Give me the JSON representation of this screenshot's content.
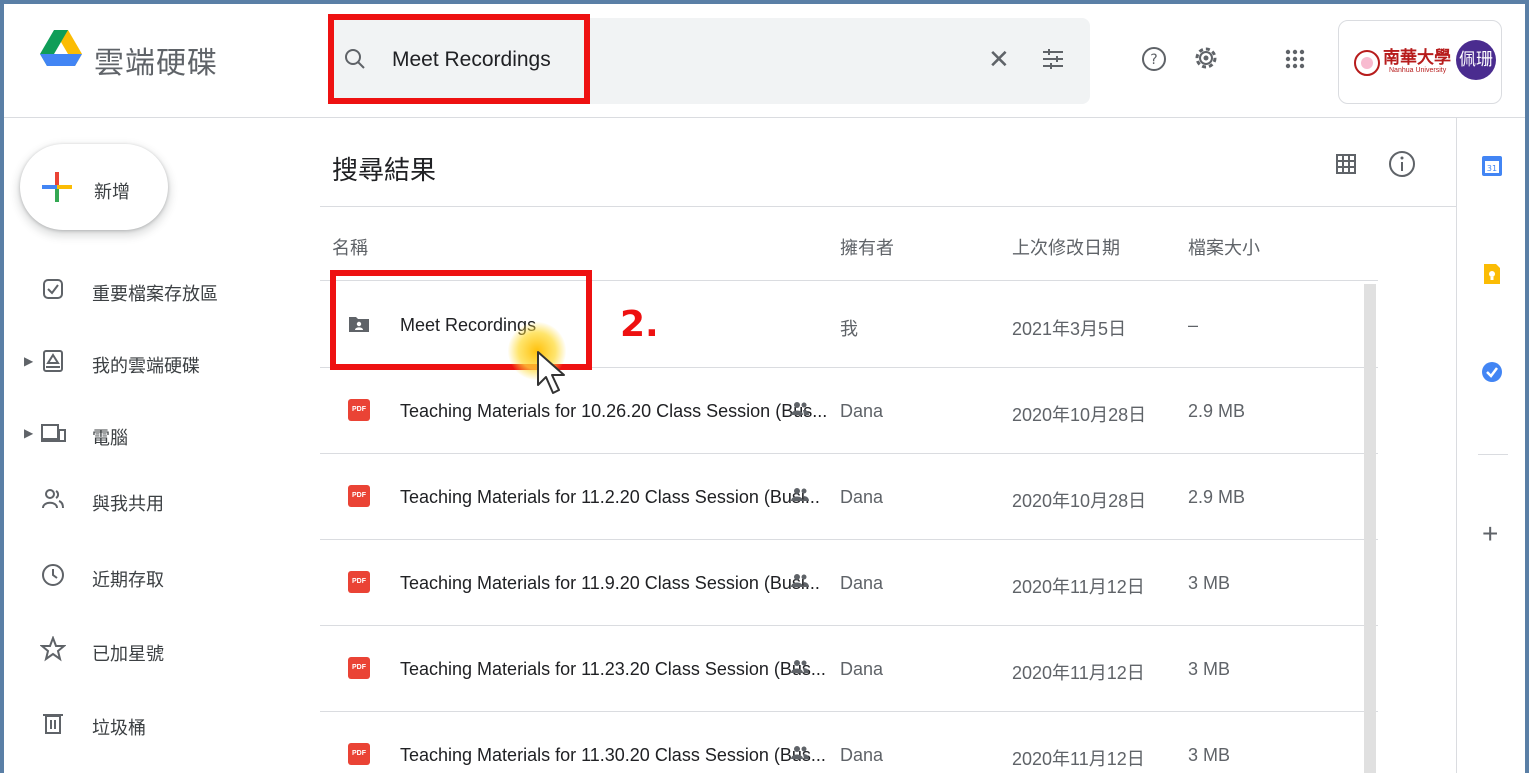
{
  "app": {
    "title": "雲端硬碟"
  },
  "search": {
    "value": "Meet Recordings"
  },
  "header": {
    "org_name": "南華大學",
    "org_sub": "Nanhua University",
    "avatar_label": "佩珊"
  },
  "sidebar": {
    "new_label": "新增",
    "items": [
      {
        "label": "重要檔案存放區",
        "icon": "priority-icon"
      },
      {
        "label": "我的雲端硬碟",
        "icon": "my-drive-icon"
      },
      {
        "label": "電腦",
        "icon": "computers-icon"
      },
      {
        "label": "與我共用",
        "icon": "shared-with-me-icon"
      },
      {
        "label": "近期存取",
        "icon": "recent-icon"
      },
      {
        "label": "已加星號",
        "icon": "starred-icon"
      },
      {
        "label": "垃圾桶",
        "icon": "trash-icon"
      }
    ]
  },
  "main": {
    "results_title": "搜尋結果",
    "columns": {
      "name": "名稱",
      "owner": "擁有者",
      "modified": "上次修改日期",
      "size": "檔案大小"
    },
    "rows": [
      {
        "name": "Meet Recordings",
        "type": "shared-folder",
        "owner": "我",
        "modified": "2021年3月5日",
        "size": "–",
        "shared": false
      },
      {
        "name": "Teaching Materials for 10.26.20 Class Session (Bus...",
        "type": "pdf",
        "owner": "Dana",
        "modified": "2020年10月28日",
        "size": "2.9 MB",
        "shared": true
      },
      {
        "name": "Teaching Materials for 11.2.20 Class Session (Busi...",
        "type": "pdf",
        "owner": "Dana",
        "modified": "2020年10月28日",
        "size": "2.9 MB",
        "shared": true
      },
      {
        "name": "Teaching Materials for 11.9.20 Class Session (Busi...",
        "type": "pdf",
        "owner": "Dana",
        "modified": "2020年11月12日",
        "size": "3 MB",
        "shared": true
      },
      {
        "name": "Teaching Materials for 11.23.20 Class Session (Bus...",
        "type": "pdf",
        "owner": "Dana",
        "modified": "2020年11月12日",
        "size": "3 MB",
        "shared": true
      },
      {
        "name": "Teaching Materials for 11.30.20 Class Session (Bus...",
        "type": "pdf",
        "owner": "Dana",
        "modified": "2020年11月12日",
        "size": "3 MB",
        "shared": true
      }
    ]
  },
  "file_badge": "PDF",
  "side_panel": {
    "calendar_day": "31",
    "apps": [
      "calendar-icon",
      "keep-icon",
      "tasks-icon"
    ]
  },
  "annotation": {
    "step_label": "2."
  },
  "colors": {
    "annotation_red": "#ee1111",
    "pdf_red": "#ea4335",
    "avatar": "#4a2c8f"
  }
}
